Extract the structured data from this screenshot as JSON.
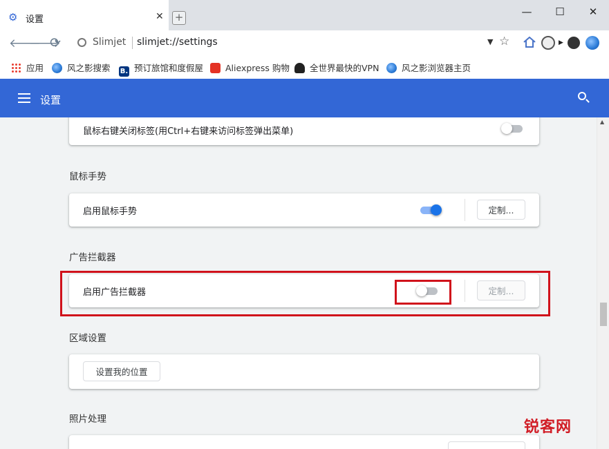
{
  "tab": {
    "title": "设置",
    "favicon": "gear-icon",
    "close": "✕",
    "new_tab": "+"
  },
  "window": {
    "minimize": "—",
    "maximize": "☐",
    "close": "✕"
  },
  "address_bar": {
    "brand": "Slimjet",
    "url": "slimjet://settings",
    "dropdown": "▼",
    "star": "☆"
  },
  "nav": {
    "back": "🡐",
    "forward": "🡒",
    "reload": "⟳"
  },
  "bookmarks": [
    {
      "label": "应用",
      "icon": "apps-grid-icon"
    },
    {
      "label": "风之影搜索",
      "icon": "globe-icon"
    },
    {
      "label": "预订旅馆和度假屋",
      "icon": "booking-icon",
      "glyph": "B."
    },
    {
      "label": "Aliexpress 购物",
      "icon": "aliexpress-icon"
    },
    {
      "label": "全世界最快的VPN",
      "icon": "vpn-icon"
    },
    {
      "label": "风之影浏览器主页",
      "icon": "globe-icon"
    }
  ],
  "header": {
    "title": "设置",
    "accent": "#3367d6"
  },
  "settings": {
    "close_tab_row": {
      "label": "鼠标右键关闭标签(用Ctrl+右键来访问标签弹出菜单)",
      "enabled": false
    },
    "mouse_gesture": {
      "section_title": "鼠标手势",
      "label": "启用鼠标手势",
      "enabled": true,
      "button": "定制..."
    },
    "ad_blocker": {
      "section_title": "广告拦截器",
      "label": "启用广告拦截器",
      "enabled": false,
      "button": "定制...",
      "highlight_color": "#d0121b"
    },
    "region": {
      "section_title": "区域设置",
      "button": "设置我的位置"
    },
    "photo": {
      "section_title": "照片处理"
    }
  },
  "watermark": "锐客网"
}
